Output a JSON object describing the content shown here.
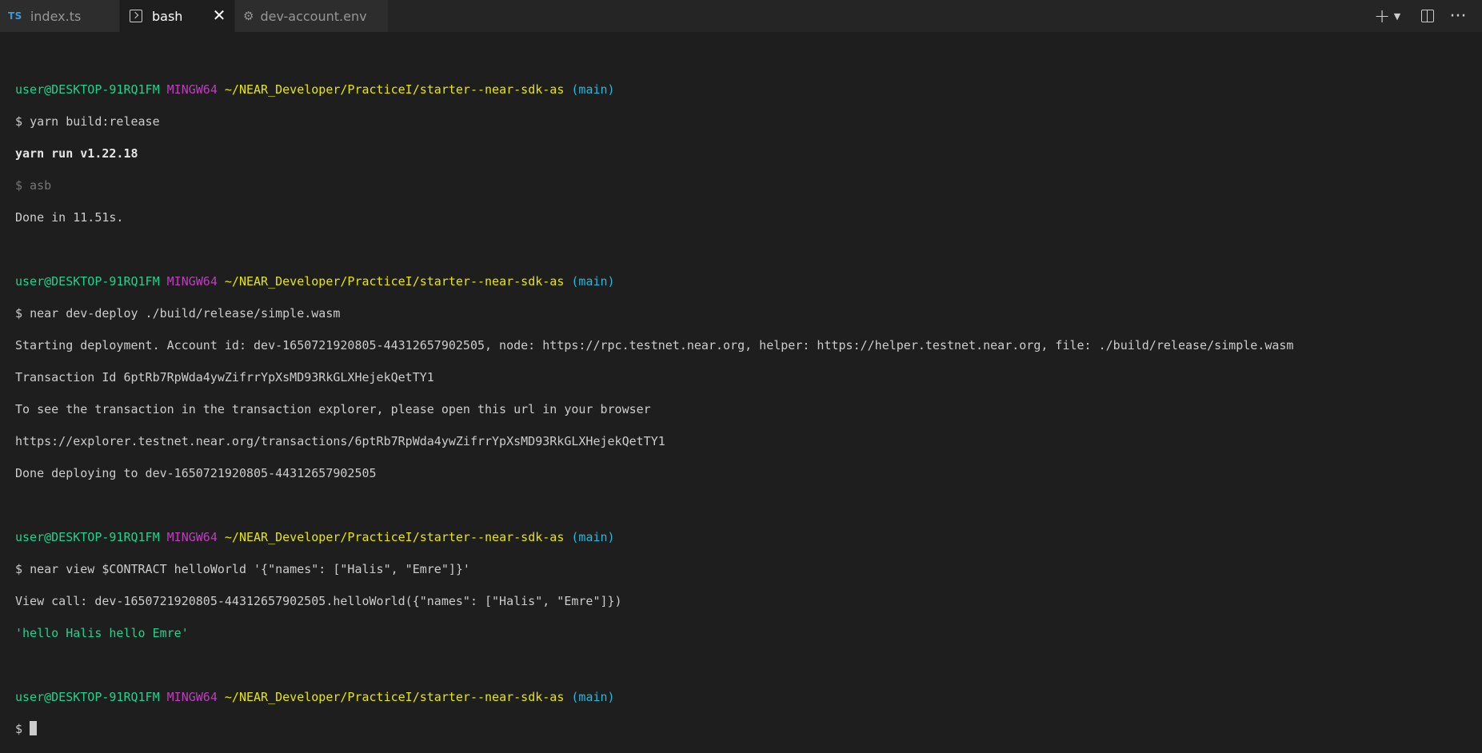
{
  "tabs": [
    {
      "icon": "TS",
      "label": "index.ts",
      "active": false
    },
    {
      "icon": "terminal-icon",
      "label": "bash",
      "active": true,
      "close": "✕"
    },
    {
      "icon": "gear-icon",
      "label": "dev-account.env",
      "active": false
    }
  ],
  "actions": {
    "new_terminal": "+",
    "chevron": "⌄",
    "more": "···"
  },
  "prompt": {
    "user": "user@DESKTOP-91RQ1FM",
    "shell": "MINGW64",
    "path": "~/NEAR_Developer/PracticeI/starter--near-sdk-as",
    "branch": "(main)",
    "symbol": "$"
  },
  "block1": {
    "command": "yarn build:release",
    "yarn_version": "yarn run v1.22.18",
    "sub_command": "$ asb",
    "done": "Done in 11.51s."
  },
  "block2": {
    "command": "near dev-deploy ./build/release/simple.wasm",
    "out1": "Starting deployment. Account id: dev-1650721920805-44312657902505, node: https://rpc.testnet.near.org, helper: https://helper.testnet.near.org, file: ./build/release/simple.wasm",
    "out2": "Transaction Id 6ptRb7RpWda4ywZifrrYpXsMD93RkGLXHejekQetTY1",
    "out3": "To see the transaction in the transaction explorer, please open this url in your browser",
    "out4": "https://explorer.testnet.near.org/transactions/6ptRb7RpWda4ywZifrrYpXsMD93RkGLXHejekQetTY1",
    "out5": "Done deploying to dev-1650721920805-44312657902505"
  },
  "block3": {
    "command": "near view $CONTRACT helloWorld '{\"names\": [\"Halis\", \"Emre\"]}'",
    "out1": "View call: dev-1650721920805-44312657902505.helloWorld({\"names\": [\"Halis\", \"Emre\"]})",
    "result": "'hello Halis hello Emre'"
  },
  "colors": {
    "background": "#1e1e1e",
    "user": "#23d18b",
    "shell": "#bc3fbc",
    "path": "#e5e510",
    "branch": "#29b8db"
  }
}
